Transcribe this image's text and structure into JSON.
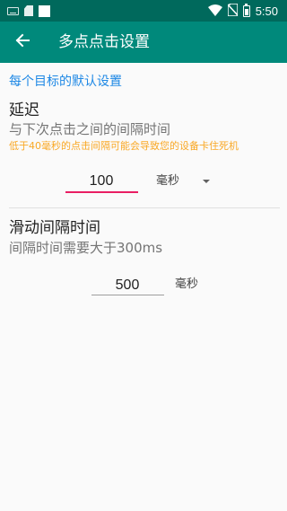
{
  "status_bar": {
    "time": "5:50",
    "left_icons": [
      "keyboard-icon",
      "sd-card-icon",
      "square-icon"
    ],
    "right_icons": [
      "wifi-icon",
      "no-sim-icon",
      "battery-icon"
    ]
  },
  "toolbar": {
    "back_icon": "arrow-back-icon",
    "title": "多点点击设置"
  },
  "section": {
    "header": "每个目标的默认设置"
  },
  "delay": {
    "title": "延迟",
    "summary": "与下次点击之间的间隔时间",
    "warning": "低于40毫秒的点击间隔可能会导致您的设备卡住死机",
    "value": "100",
    "unit": "毫秒"
  },
  "swipe": {
    "title": "滑动间隔时间",
    "summary": "间隔时间需要大于300ms",
    "value": "500",
    "unit": "毫秒"
  },
  "colors": {
    "status_bar": "#00695c",
    "toolbar": "#00897b",
    "accent": "#e91e63",
    "section_header": "#1e88e5",
    "warning": "#f9a825"
  }
}
